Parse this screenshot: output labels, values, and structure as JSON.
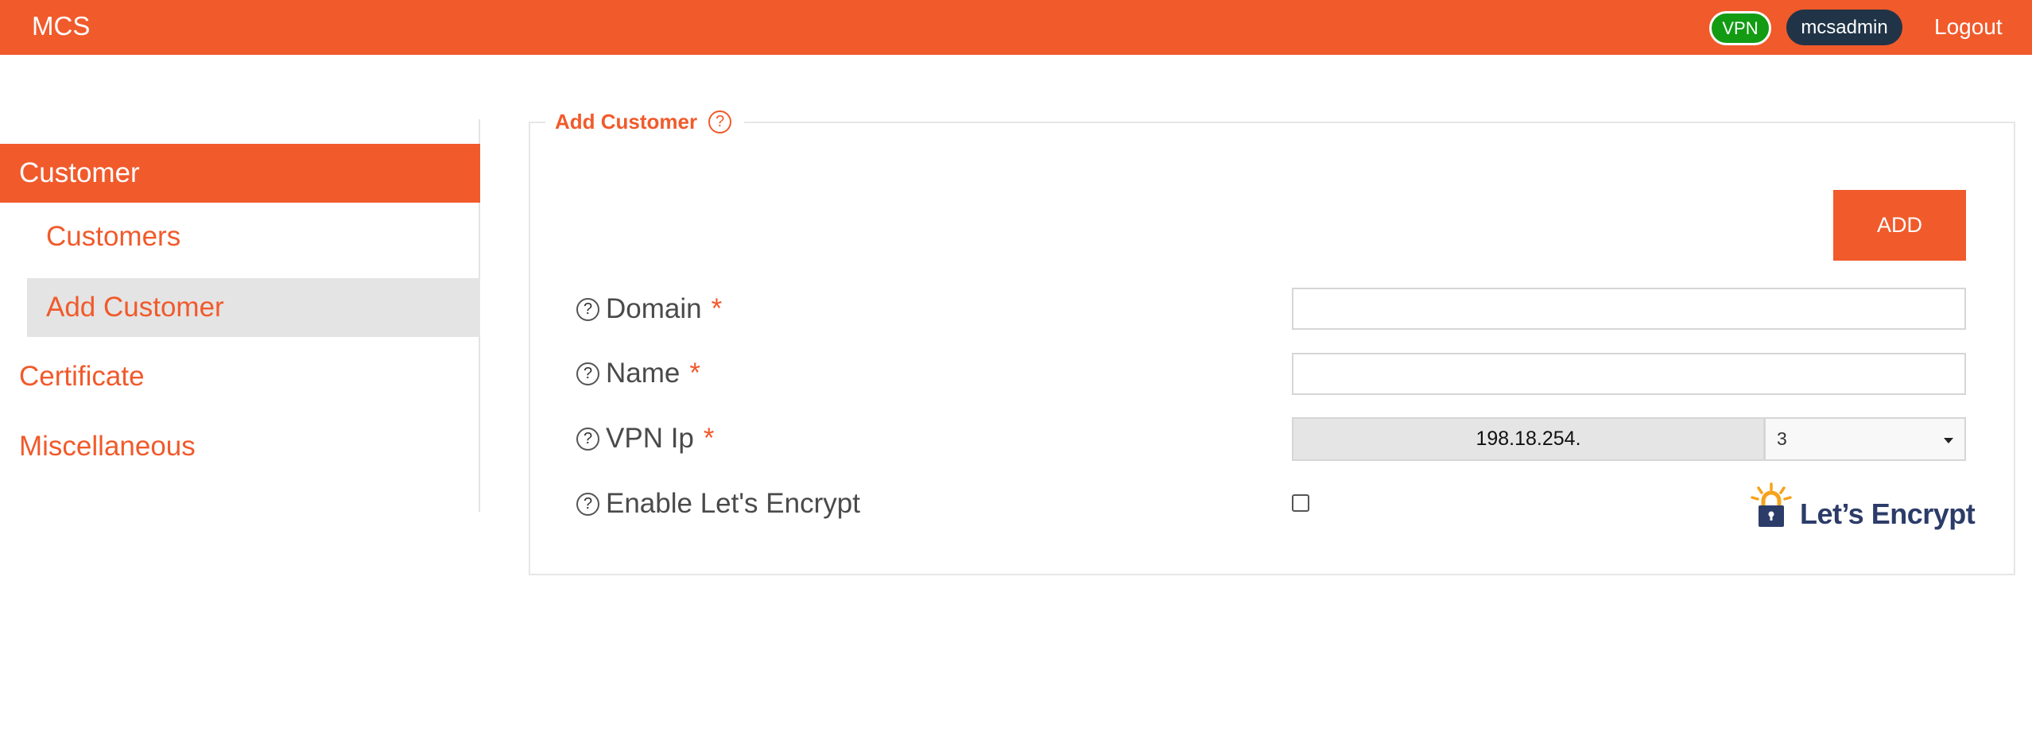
{
  "header": {
    "brand": "MCS",
    "vpn_badge": "VPN",
    "username": "mcsadmin",
    "logout_label": "Logout"
  },
  "sidebar": {
    "group": "Customer",
    "sub_items": [
      {
        "label": "Customers",
        "active": false
      },
      {
        "label": "Add Customer",
        "active": true
      }
    ],
    "top_items": [
      {
        "label": "Certificate"
      },
      {
        "label": "Miscellaneous"
      }
    ]
  },
  "form": {
    "legend": "Add Customer",
    "help_glyph": "?",
    "add_button": "ADD",
    "required_marker": "*",
    "fields": {
      "domain": {
        "label": "Domain",
        "value": ""
      },
      "name": {
        "label": "Name",
        "value": ""
      },
      "vpn_ip": {
        "label": "VPN Ip",
        "prefix": "198.18.254.",
        "selected": "3"
      },
      "lets_encrypt": {
        "label": "Enable Let's Encrypt",
        "checked": false
      }
    },
    "logo_text": "Let’s Encrypt"
  },
  "colors": {
    "accent": "#f15a2b",
    "vpn_badge": "#139b14",
    "user_badge": "#213447",
    "logo_navy": "#2c3c69",
    "logo_gold": "#f6a21c"
  },
  "icons": {
    "help": "question-circle-icon",
    "dropdown": "caret-down-icon",
    "logo": "lets-encrypt-lock-icon"
  }
}
